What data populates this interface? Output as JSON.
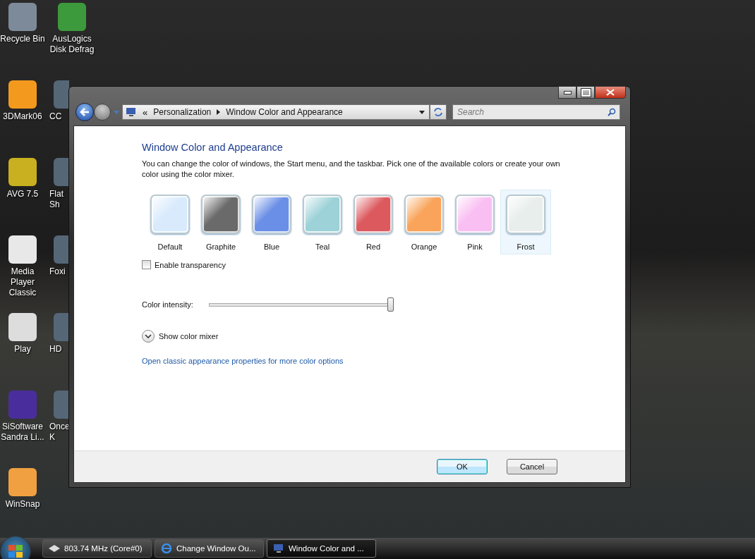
{
  "desktop_icons": [
    {
      "label": "Recycle Bin",
      "kind": "bin"
    },
    {
      "label": "AusLogics Disk Defrag",
      "kind": "defrag"
    },
    {
      "label": "3DMark06",
      "kind": "mark"
    },
    {
      "label": "CC",
      "kind": "app"
    },
    {
      "label": "AVG 7.5",
      "kind": "avg"
    },
    {
      "label": "Flat Sh",
      "kind": "app"
    },
    {
      "label": "Media Player Classic",
      "kind": "player"
    },
    {
      "label": "Foxi",
      "kind": "app"
    },
    {
      "label": "Play",
      "kind": "play"
    },
    {
      "label": "HD",
      "kind": "app"
    },
    {
      "label": "SiSoftware Sandra Li...",
      "kind": "sandra"
    },
    {
      "label": "Once K",
      "kind": "app"
    },
    {
      "label": "WinSnap",
      "kind": "snap"
    }
  ],
  "window": {
    "overflow_chevron": "«",
    "breadcrumb": [
      "Personalization",
      "Window Color and Appearance"
    ],
    "search": {
      "placeholder": "Search"
    },
    "heading": "Window Color and Appearance",
    "description": "You can change the color of windows, the Start menu, and the taskbar. Pick one of the available colors or create your own color using the color mixer.",
    "swatches": [
      {
        "label": "Default",
        "color": "#d8eafc",
        "selected": false
      },
      {
        "label": "Graphite",
        "color": "#6a6a6a",
        "selected": false
      },
      {
        "label": "Blue",
        "color": "#6a8fe6",
        "selected": false
      },
      {
        "label": "Teal",
        "color": "#9dd2d8",
        "selected": false
      },
      {
        "label": "Red",
        "color": "#dc5a5e",
        "selected": false
      },
      {
        "label": "Orange",
        "color": "#f9a45a",
        "selected": false
      },
      {
        "label": "Pink",
        "color": "#f9bff2",
        "selected": false
      },
      {
        "label": "Frost",
        "color": "#e8eeec",
        "selected": true
      }
    ],
    "transparency": {
      "label": "Enable transparency",
      "checked": false
    },
    "intensity": {
      "label": "Color intensity:",
      "level": 1
    },
    "mixer": {
      "label": "Show color mixer",
      "expanded": false
    },
    "link": "Open classic appearance properties for more color options",
    "buttons": [
      "OK",
      "Cancel"
    ]
  },
  "taskbar": [
    {
      "label": "803.74 MHz (Core#0)",
      "kind": "cpu",
      "selected": false
    },
    {
      "label": "Change Window Ou...",
      "kind": "ie",
      "selected": false
    },
    {
      "label": "Window Color and ...",
      "kind": "display",
      "selected": true
    }
  ]
}
